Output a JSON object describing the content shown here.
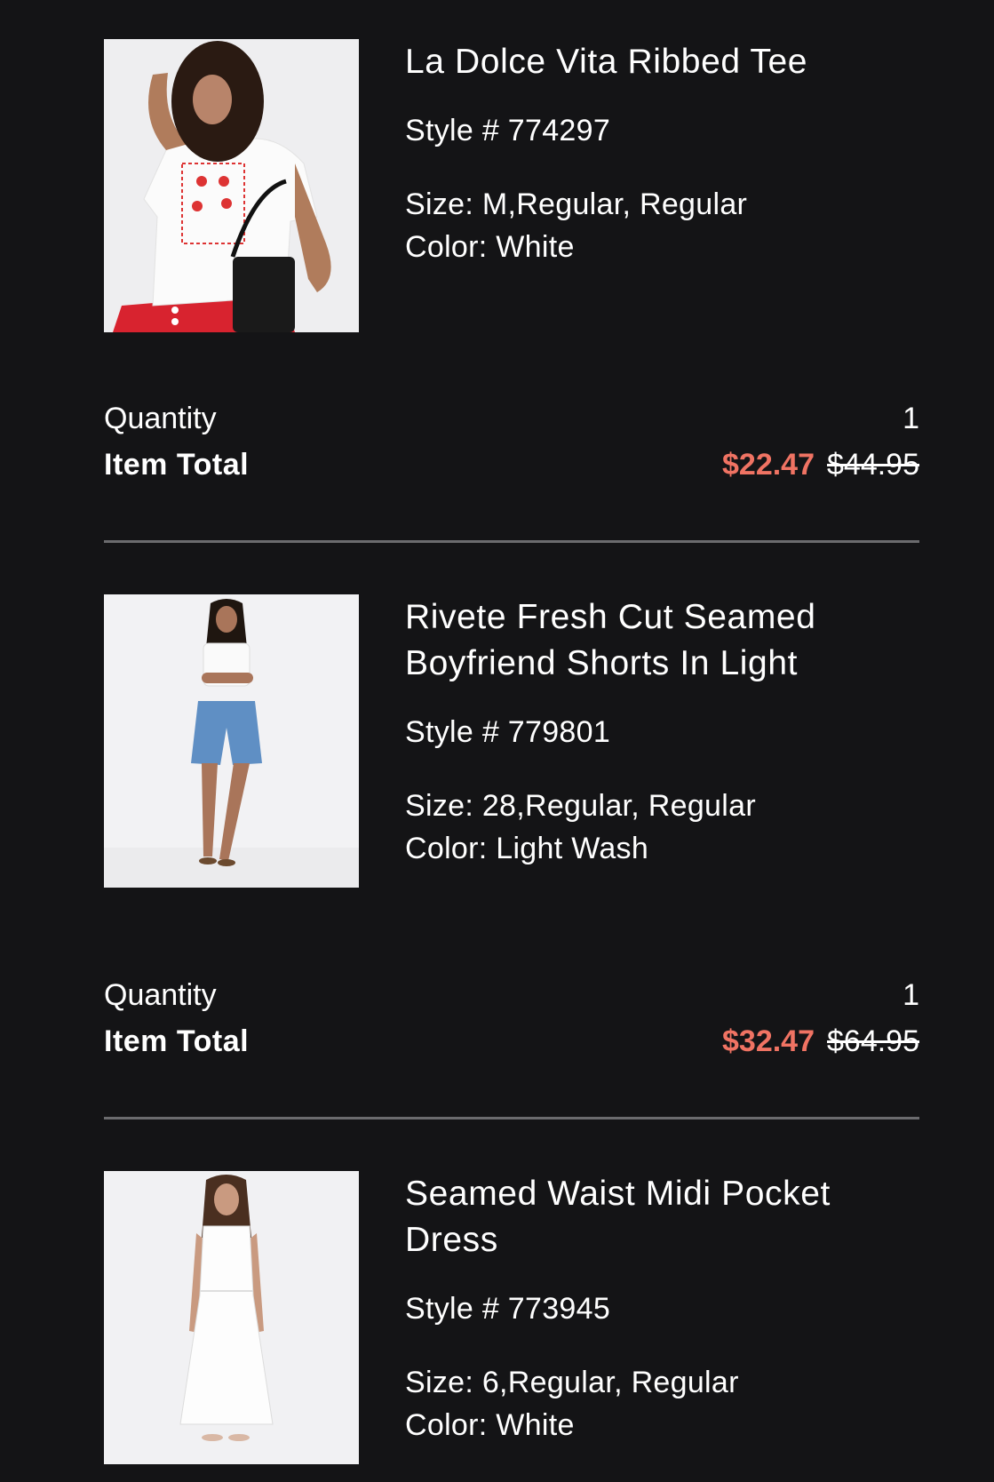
{
  "colors": {
    "background": "#141416",
    "text": "#ffffff",
    "sale_price": "#f07363",
    "divider": "#6b6b6e",
    "image_background": "#f1f1f3"
  },
  "labels": {
    "quantity": "Quantity",
    "item_total": "Item Total"
  },
  "items": [
    {
      "name": "La Dolce Vita Ribbed Tee",
      "style": "Style # 774297",
      "size": "Size: M,Regular, Regular",
      "color": "Color: White",
      "quantity": "1",
      "sale_price": "$22.47",
      "original_price": "$44.95",
      "image_icon": "product-photo-tee"
    },
    {
      "name": "Rivete Fresh Cut Seamed Boyfriend Shorts In Light",
      "style": "Style # 779801",
      "size": "Size: 28,Regular, Regular",
      "color": "Color: Light Wash",
      "quantity": "1",
      "sale_price": "$32.47",
      "original_price": "$64.95",
      "image_icon": "product-photo-shorts"
    },
    {
      "name": "Seamed Waist Midi Pocket Dress",
      "style": "Style # 773945",
      "size": "Size: 6,Regular, Regular",
      "color": "Color: White",
      "image_icon": "product-photo-dress"
    }
  ]
}
